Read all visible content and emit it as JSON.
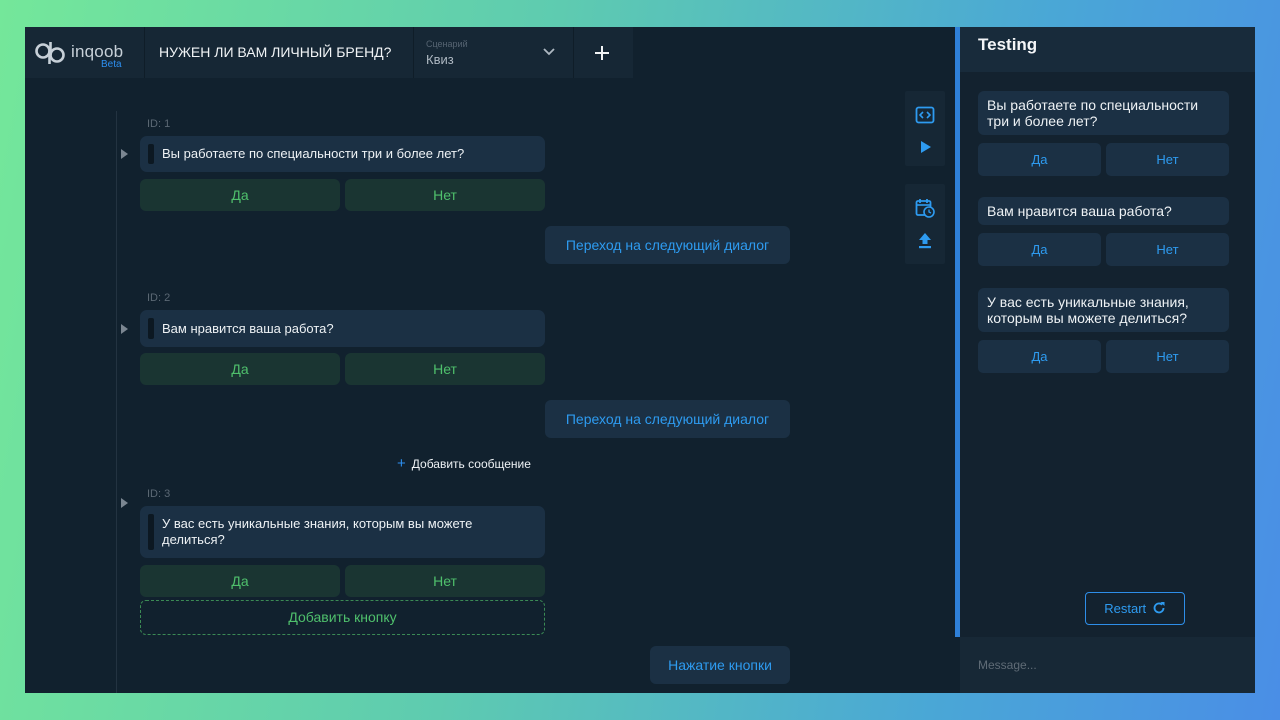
{
  "app": {
    "logo_text": "inqoob",
    "logo_badge": "Beta",
    "title": "НУЖЕН ЛИ ВАМ ЛИЧНЫЙ БРЕНД?",
    "scenario_caption": "Сценарий",
    "scenario_value": "Квиз"
  },
  "canvas": {
    "dialogs": [
      {
        "id": "ID: 1",
        "text": "Вы работаете по специальности три и более лет?",
        "buttons": [
          "Да",
          "Нет"
        ],
        "transition": "Переход на следующий диалог"
      },
      {
        "id": "ID: 2",
        "text": "Вам нравится ваша работа?",
        "buttons": [
          "Да",
          "Нет"
        ],
        "transition": "Переход на следующий диалог"
      },
      {
        "id": "ID: 3",
        "text": "У вас есть уникальные знания, которым вы можете делиться?",
        "buttons": [
          "Да",
          "Нет"
        ],
        "transition": "Нажатие кнопки"
      }
    ],
    "add_message": "Добавить сообщение",
    "add_button": "Добавить кнопку"
  },
  "toolbar": {
    "icons": [
      "code-icon",
      "play-icon",
      "calendar-clock-icon",
      "upload-icon"
    ]
  },
  "testing": {
    "title": "Testing",
    "messages": [
      {
        "text": "Вы работаете по специальности три и более лет?",
        "buttons": [
          "Да",
          "Нет"
        ]
      },
      {
        "text": "Вам нравится ваша работа?",
        "buttons": [
          "Да",
          "Нет"
        ]
      },
      {
        "text": "У вас есть уникальные знания, которым вы можете делиться?",
        "buttons": [
          "Да",
          "Нет"
        ]
      }
    ],
    "restart_label": "Restart",
    "input_placeholder": "Message..."
  },
  "colors": {
    "accent": "#2e9bf0",
    "choice_green": "#4fc06c",
    "panel_bg": "#11212e",
    "bubble_bg": "#1b3044"
  }
}
